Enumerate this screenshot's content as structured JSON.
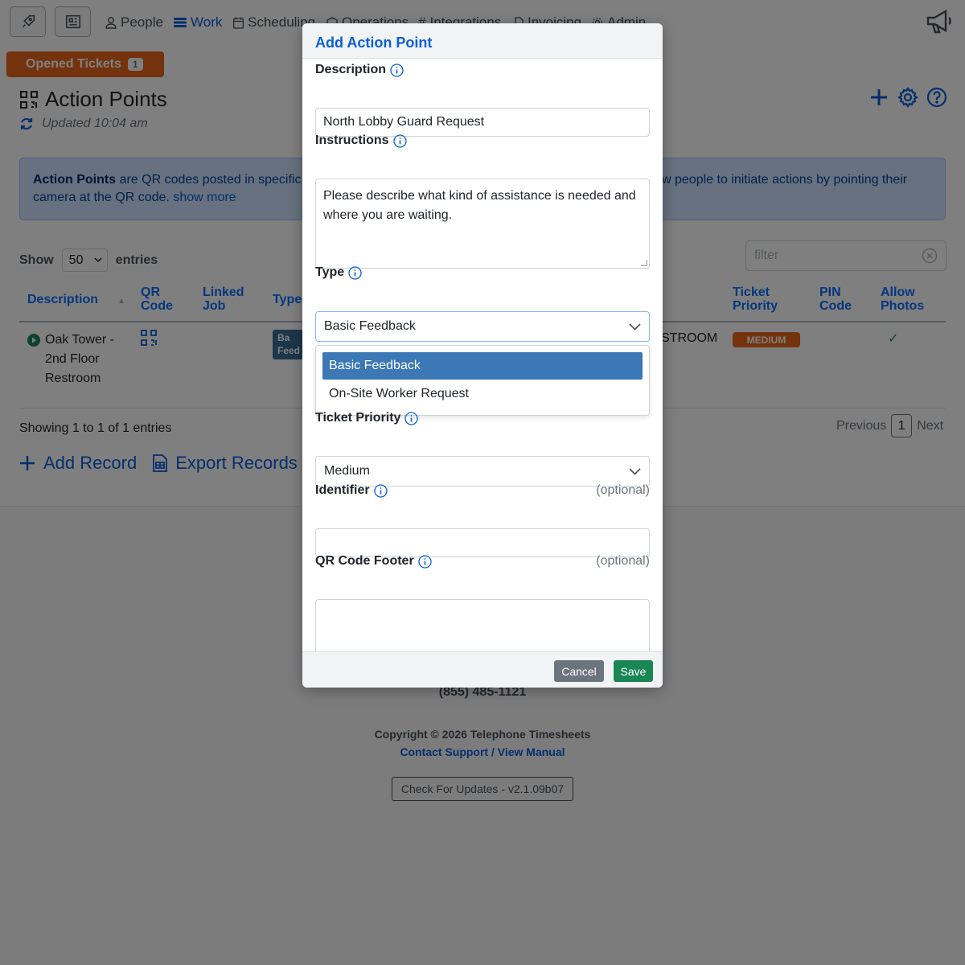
{
  "nav": {
    "items": [
      {
        "label": "People",
        "icon": "person-icon"
      },
      {
        "label": "Work",
        "icon": "stack-icon"
      },
      {
        "label": "Scheduling",
        "icon": "calendar-icon"
      },
      {
        "label": "Operations",
        "icon": "box-icon"
      },
      {
        "label": "Integrations",
        "icon": "hash-icon"
      },
      {
        "label": "Invoicing",
        "icon": "file-icon"
      },
      {
        "label": "Admin",
        "icon": "gear-icon"
      }
    ],
    "active": "Work"
  },
  "opened_tickets": {
    "label": "Opened Tickets",
    "count": "1"
  },
  "page": {
    "title": "Action Points",
    "updated": "Updated 10:04 am"
  },
  "alert": {
    "bold": "Action Points",
    "text_a": " are QR codes posted in specific",
    "text_b": "w people to initiate actions by pointing their",
    "text_c": "camera at the QR code. ",
    "show_more": "show more"
  },
  "table_controls": {
    "show_label": "Show",
    "entries_value": "50",
    "entries_label": "entries",
    "filter_placeholder": "filter"
  },
  "table": {
    "headers": [
      "Description",
      "QR Code",
      "Linked Job",
      "Type",
      "Ticket Priority",
      "PIN Code",
      "Allow Photos"
    ],
    "header_lines": {
      "qr": [
        "QR",
        "Code"
      ],
      "linked": [
        "Linked",
        "Job"
      ],
      "ticket": [
        "Ticket",
        "Priority"
      ],
      "pin": [
        "PIN",
        "Code"
      ],
      "photos": [
        "Allow",
        "Photos"
      ]
    },
    "row": {
      "description": [
        "Oak Tower -",
        "2nd Floor",
        "Restroom"
      ],
      "type_badge": [
        "Ba",
        "Feed"
      ],
      "location": "STROOM",
      "priority": "MEDIUM",
      "allow_photos": "✓"
    },
    "showing": "Showing 1 to 1 of 1 entries",
    "pager": {
      "previous": "Previous",
      "page": "1",
      "next": "Next"
    }
  },
  "actions": {
    "add": "Add Record",
    "export": "Export Records"
  },
  "footer": {
    "phone": "(855) 485-1121",
    "copyright": "Copyright © 2026 Telephone Timesheets",
    "contact": "Contact Support",
    "separator": " / ",
    "manual": "View Manual",
    "update": "Check For Updates - v2.1.09b07"
  },
  "modal": {
    "title": "Add Action Point",
    "description": {
      "label": "Description",
      "value": "North Lobby Guard Request"
    },
    "instructions": {
      "label": "Instructions",
      "value": "Please describe what kind of assistance is needed and where you are waiting."
    },
    "type": {
      "label": "Type",
      "value": "Basic Feedback",
      "options": [
        "Basic Feedback",
        "On-Site Worker Request"
      ]
    },
    "ticket_priority": {
      "label": "Ticket Priority",
      "value": "Medium"
    },
    "identifier": {
      "label": "Identifier",
      "optional": "(optional)",
      "value": ""
    },
    "qr_footer": {
      "label": "QR Code Footer",
      "optional": "(optional)",
      "value": ""
    },
    "buttons": {
      "cancel": "Cancel",
      "save": "Save"
    }
  },
  "colors": {
    "brand_blue": "#0b5ed7",
    "orange": "#e8671a",
    "save_green": "#198754",
    "selected_option": "#3b78b5"
  }
}
